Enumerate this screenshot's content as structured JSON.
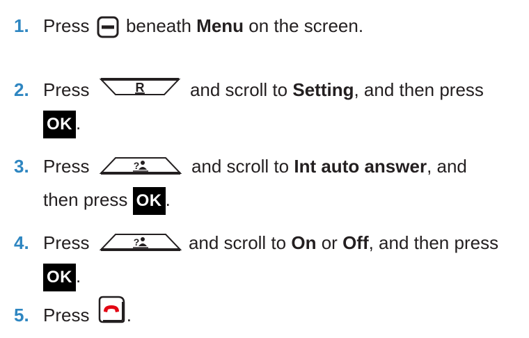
{
  "steps": [
    {
      "number": "1.",
      "text_before": "Press",
      "text_mid": "beneath",
      "bold1": "Menu",
      "text_after": "on the screen."
    },
    {
      "number": "2.",
      "text_before": "Press",
      "key_label": "R",
      "text_mid": "and scroll to",
      "bold1": "Setting",
      "text_after": ", and then press",
      "ok_label": "OK",
      "end": "."
    },
    {
      "number": "3.",
      "text_before": "Press",
      "key_label": "?&#x265F;",
      "text_mid": "and scroll to",
      "bold1": "Int auto answer",
      "text_after": ", and",
      "line2": "then press",
      "ok_label": "OK",
      "end": "."
    },
    {
      "number": "4.",
      "text_before": "Press",
      "text_mid": "and scroll to",
      "bold1": "On",
      "text_or": "or",
      "bold2": "Off",
      "text_after": ", and then press",
      "ok_label": "OK",
      "end": "."
    },
    {
      "number": "5.",
      "text_before": "Press",
      "end": "."
    }
  ],
  "icons": {
    "menu_key": "soft-key-icon",
    "nav_down": "nav-down-key-icon",
    "nav_up": "nav-up-key-icon",
    "end_call": "end-call-key-icon",
    "end_call_color": "#e30613",
    "number_color": "#2e86c1"
  }
}
